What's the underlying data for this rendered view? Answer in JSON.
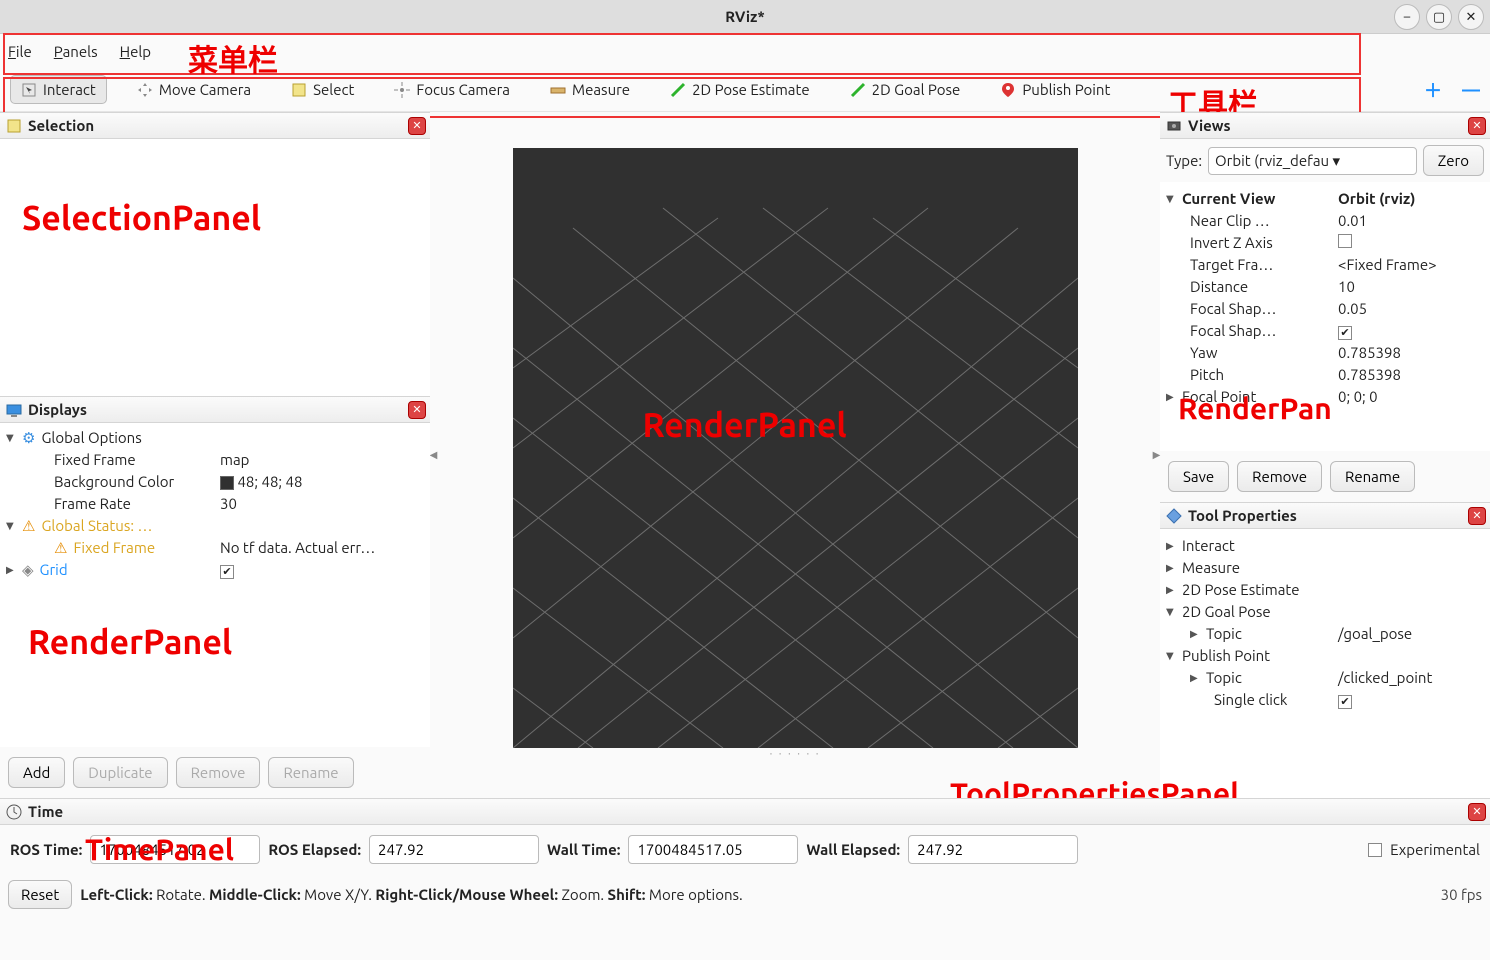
{
  "titlebar": {
    "title": "RViz*"
  },
  "menubar": {
    "file": "File",
    "panels": "Panels",
    "help": "Help"
  },
  "annotations": {
    "menubar": "菜单栏",
    "toolbar": "工具栏",
    "selection": "SelectionPanel",
    "displays": "RenderPanel",
    "render": "RenderPanel",
    "views": "RenderPan",
    "toolprops": "ToolPropertiesPanel",
    "time": "TimePanel"
  },
  "toolbar": {
    "interact": "Interact",
    "move_camera": "Move Camera",
    "select": "Select",
    "focus_camera": "Focus Camera",
    "measure": "Measure",
    "pose_estimate": "2D Pose Estimate",
    "goal_pose": "2D Goal Pose",
    "publish_point": "Publish Point"
  },
  "panels": {
    "selection_title": "Selection",
    "displays_title": "Displays",
    "views_title": "Views",
    "toolprops_title": "Tool Properties",
    "time_title": "Time"
  },
  "displays": {
    "global_options": "Global Options",
    "fixed_frame_label": "Fixed Frame",
    "fixed_frame_value": "map",
    "background_color_label": "Background Color",
    "background_color_value": "48; 48; 48",
    "frame_rate_label": "Frame Rate",
    "frame_rate_value": "30",
    "global_status": "Global Status: …",
    "fixed_frame_status_label": "Fixed Frame",
    "fixed_frame_status_value": "No tf data.  Actual err…",
    "grid": "Grid",
    "buttons": {
      "add": "Add",
      "duplicate": "Duplicate",
      "remove": "Remove",
      "rename": "Rename"
    }
  },
  "views": {
    "type_label": "Type:",
    "type_value": "Orbit (rviz_defau",
    "zero": "Zero",
    "current_view_label": "Current View",
    "current_view_value": "Orbit (rviz)",
    "near_clip_label": "Near Clip …",
    "near_clip_value": "0.01",
    "invert_z_label": "Invert Z Axis",
    "target_frame_label": "Target Fra…",
    "target_frame_value": "<Fixed Frame>",
    "distance_label": "Distance",
    "distance_value": "10",
    "focal_shape1_label": "Focal Shap…",
    "focal_shape1_value": "0.05",
    "focal_shape2_label": "Focal Shap…",
    "yaw_label": "Yaw",
    "yaw_value": "0.785398",
    "pitch_label": "Pitch",
    "pitch_value": "0.785398",
    "focal_point_label": "Focal Point",
    "focal_point_value": "0; 0; 0",
    "buttons": {
      "save": "Save",
      "remove": "Remove",
      "rename": "Rename"
    }
  },
  "toolprops": {
    "interact": "Interact",
    "measure": "Measure",
    "pose_estimate": "2D Pose Estimate",
    "goal_pose": "2D Goal Pose",
    "topic_label": "Topic",
    "goal_topic_value": "/goal_pose",
    "publish_point": "Publish Point",
    "clicked_topic_value": "/clicked_point",
    "single_click": "Single click"
  },
  "time": {
    "ros_time_label": "ROS Time:",
    "ros_time_value": "1700484517.02",
    "ros_elapsed_label": "ROS Elapsed:",
    "ros_elapsed_value": "247.92",
    "wall_time_label": "Wall Time:",
    "wall_time_value": "1700484517.05",
    "wall_elapsed_label": "Wall Elapsed:",
    "wall_elapsed_value": "247.92",
    "experimental": "Experimental"
  },
  "statusbar": {
    "reset": "Reset",
    "hint_left": "Left-Click:",
    "hint_left_v": " Rotate. ",
    "hint_mid": "Middle-Click:",
    "hint_mid_v": " Move X/Y. ",
    "hint_right": "Right-Click/Mouse Wheel:",
    "hint_right_v": " Zoom. ",
    "hint_shift": "Shift:",
    "hint_shift_v": " More options.",
    "fps": "30 fps"
  }
}
